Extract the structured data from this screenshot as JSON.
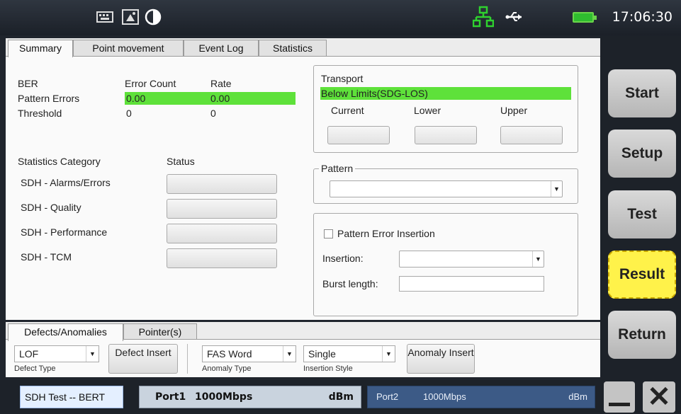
{
  "topbar": {
    "icons": [
      "keyboard-icon",
      "screenshot-icon",
      "contrast-icon",
      "network-icon",
      "usb-icon",
      "battery-icon"
    ],
    "time": "17:06:30",
    "network_color": "#2fd12f",
    "battery_color": "#2fbd2f"
  },
  "tabs": [
    "Summary",
    "Point movement",
    "Event Log",
    "Statistics"
  ],
  "ber": {
    "title": "BER",
    "col_error_count": "Error Count",
    "col_rate": "Rate",
    "pattern_errors_label": "Pattern Errors",
    "pattern_errors_count": "0.00",
    "pattern_errors_rate": "0.00",
    "threshold_label": "Threshold",
    "threshold_count": "0",
    "threshold_rate": "0",
    "highlight_color": "#5ee13a"
  },
  "statistics": {
    "category_header": "Statistics Category",
    "status_header": "Status",
    "rows": [
      "SDH - Alarms/Errors",
      "SDH - Quality",
      "SDH - Performance",
      "SDH - TCM"
    ]
  },
  "transport": {
    "title": "Transport",
    "status": "Below Limits(SDG-LOS)",
    "current": "Current",
    "lower": "Lower",
    "upper": "Upper"
  },
  "pattern": {
    "title": "Pattern",
    "value": ""
  },
  "insertion": {
    "checkbox_label": "Pattern Error Insertion",
    "insertion_label": "Insertion:",
    "burst_label": "Burst length:"
  },
  "bottom_tabs": [
    "Defects/Anomalies",
    "Pointer(s)"
  ],
  "defects": {
    "defect_type_value": "LOF",
    "defect_type_label": "Defect Type",
    "defect_insert": "Defect Insert",
    "anomaly_type_value": "FAS Word",
    "anomaly_type_label": "Anomaly Type",
    "insertion_style_value": "Single",
    "insertion_style_label": "Insertion Style",
    "anomaly_insert": "Anomaly Insert"
  },
  "footer": {
    "test_name": "SDH Test -- BERT",
    "port1_name": "Port1",
    "port1_speed": "1000Mbps",
    "port1_unit": "dBm",
    "port2_name": "Port2",
    "port2_speed": "1000Mbps",
    "port2_unit": "dBm"
  },
  "side_buttons": [
    "Start",
    "Setup",
    "Test",
    "Result",
    "Return"
  ],
  "active_button_color": "#fff24a"
}
